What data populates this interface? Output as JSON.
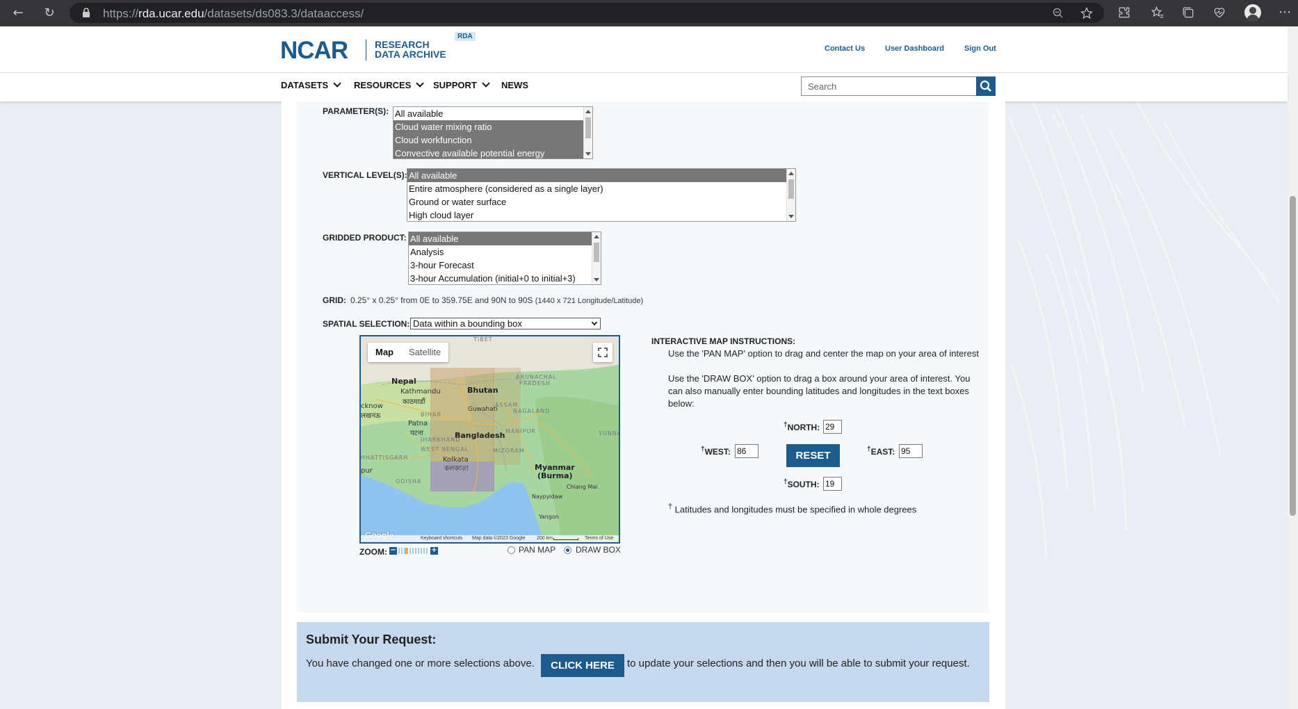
{
  "browser": {
    "url_prefix": "https://",
    "url_host": "rda.ucar.edu",
    "url_path": "/datasets/ds083.3/dataaccess/"
  },
  "header": {
    "logo": "NCAR",
    "logo_sub_line1": "RESEARCH",
    "logo_sub_line2": "DATA ARCHIVE",
    "badge": "RDA",
    "links": [
      "Contact Us",
      "User Dashboard",
      "Sign Out"
    ]
  },
  "nav": {
    "items": [
      "DATASETS",
      "RESOURCES",
      "SUPPORT",
      "NEWS"
    ],
    "search_placeholder": "Search"
  },
  "form": {
    "parameters_label": "PARAMETER(S):",
    "parameters": [
      "All available",
      "Cloud water mixing ratio",
      "Cloud workfunction",
      "Convective available potential energy"
    ],
    "vertical_label": "VERTICAL LEVEL(S):",
    "vertical_levels": [
      "All available",
      "Entire atmosphere (considered as a single layer)",
      "Ground or water surface",
      "High cloud layer"
    ],
    "gridded_label": "GRIDDED PRODUCT:",
    "gridded_products": [
      "All available",
      "Analysis",
      "3-hour Forecast",
      "3-hour Accumulation (initial+0 to initial+3)"
    ],
    "grid_label": "GRID:",
    "grid_text": "0.25° x 0.25° from 0E to 359.75E and 90N to 90S",
    "grid_note": "(1440 x 721 Longitude/Latitude)",
    "spatial_label": "SPATIAL SELECTION:",
    "spatial_value": "Data within a bounding box"
  },
  "map": {
    "tabs": [
      "Map",
      "Satellite"
    ],
    "places": {
      "tibet": "TIBET",
      "nepal": "Nepal",
      "kathmandu": "Kathmandu",
      "kathmandu_local": "काठमाडौं",
      "bhutan": "Bhutan",
      "guwahati": "Guwahati",
      "assam": "ASSAM",
      "arunachal": "ARUNACHAL",
      "pradesh": "PRADESH",
      "nagaland": "NAGALAND",
      "lucknow": "cknow",
      "lucknow_local": "लखनऊ",
      "bihar": "BIHAR",
      "patna": "Patna",
      "patna_local": "पटना",
      "bangladesh": "Bangladesh",
      "manipur": "MANIPUR",
      "jharkhand": "JHARKHAND",
      "west_bengal": "WEST BENGAL",
      "hattisgarh": "HHATTISGARH",
      "kolkata": "Kolkata",
      "kolkata_local": "কলকাতা",
      "mizoram": "MIZORAM",
      "myanmar": "Myanmar",
      "burma": "(Burma)",
      "pur": "pur",
      "odisha": "ODISHA",
      "chiang_mai": "Chiang Mai",
      "naypyidaw": "Naypyidaw",
      "yangon": "Yangon",
      "yunna": "YUNNA"
    },
    "footer": [
      "Keyboard shortcuts",
      "Map data ©2023 Google",
      "200 km",
      "Terms of Use"
    ],
    "google": "Google",
    "zoom_label": "ZOOM:",
    "zoom_minus": "−",
    "zoom_plus": "+",
    "mode_pan": "PAN MAP",
    "mode_draw": "DRAW BOX",
    "mode_selected": "DRAW BOX"
  },
  "instructions": {
    "title": "INTERACTIVE MAP INSTRUCTIONS:",
    "line1": "Use the 'PAN MAP' option to drag and center the map on your area of interest",
    "line2": "Use the 'DRAW BOX' option to drag a box around your area of interest. You can also manually enter bounding latitudes and longitudes in the text boxes below:",
    "north_label": "NORTH:",
    "north": "29",
    "west_label": "WEST:",
    "west": "86",
    "east_label": "EAST:",
    "east": "95",
    "south_label": "SOUTH:",
    "south": "19",
    "reset": "RESET",
    "dagger": "†",
    "note": "Latitudes and longitudes must be specified in whole degrees"
  },
  "submit": {
    "title": "Submit Your Request:",
    "text_before": "You have changed one or more selections above.",
    "button": "CLICK HERE",
    "text_after": "to update your selections and then you will be able to submit your request."
  },
  "colors": {
    "brand": "#1d5b8c",
    "selected_option": "#777777",
    "submit_bg": "#c5d8ed"
  }
}
